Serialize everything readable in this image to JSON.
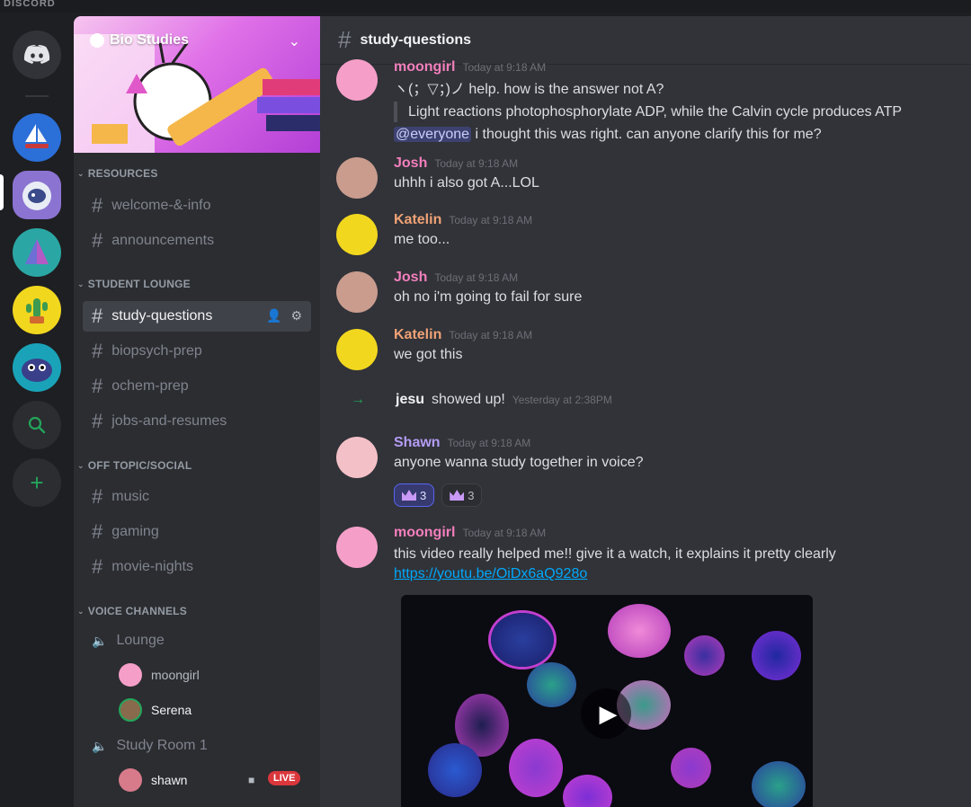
{
  "app": {
    "brand": "DISCORD"
  },
  "server": {
    "name": "Bio Studies",
    "categories": {
      "resources": "RESOURCES",
      "student_lounge": "STUDENT LOUNGE",
      "off_topic": "OFF TOPIC/SOCIAL",
      "voice": "VOICE CHANNELS"
    },
    "channels": {
      "welcome": "welcome-&-info",
      "announcements": "announcements",
      "study_questions": "study-questions",
      "biopsych": "biopsych-prep",
      "ochem": "ochem-prep",
      "jobs": "jobs-and-resumes",
      "music": "music",
      "gaming": "gaming",
      "movie": "movie-nights"
    },
    "voice_channels": {
      "lounge": "Lounge",
      "lounge_users": [
        "moongirl",
        "Serena"
      ],
      "study_room": "Study Room 1",
      "study_room_users": [
        "shawn"
      ],
      "live_badge": "LIVE"
    }
  },
  "chat": {
    "channel_title": "study-questions",
    "messages": [
      {
        "user": "moongirl",
        "time": "Today at 9:18 AM",
        "color": "#f47fbd",
        "line1": "ヽ(；▽；)ノ help. how is the answer not A?",
        "quote": "Light reactions photophosphorylate ADP, while the Calvin cycle produces ATP",
        "mention": "@everyone",
        "line3": " i thought this was right. can anyone clarify this for me?"
      },
      {
        "user": "Josh",
        "time": "Today at 9:18 AM",
        "color": "#f47fbd",
        "text": "uhhh i also got A...LOL"
      },
      {
        "user": "Katelin",
        "time": "Today at 9:18 AM",
        "color": "#f0a276",
        "text": "me too..."
      },
      {
        "user": "Josh",
        "time": "Today at 9:18 AM",
        "color": "#f47fbd",
        "text": "oh no i'm going to fail for sure"
      },
      {
        "user": "Katelin",
        "time": "Today at 9:18 AM",
        "color": "#f0a276",
        "text": "we got this"
      },
      {
        "user": "Shawn",
        "time": "Today at 9:18 AM",
        "color": "#b49cf5",
        "text": "anyone wanna study together in voice?"
      },
      {
        "user": "moongirl",
        "time": "Today at 9:18 AM",
        "color": "#f47fbd",
        "text": "this video really helped me!! give it a watch, it explains it pretty clearly",
        "link": "https://youtu.be/OiDx6aQ928o"
      }
    ],
    "join": {
      "user": "jesu",
      "text": "showed up!",
      "time": "Yesterday at 2:38PM"
    },
    "reactions": [
      {
        "count": "3"
      },
      {
        "count": "3"
      }
    ]
  }
}
